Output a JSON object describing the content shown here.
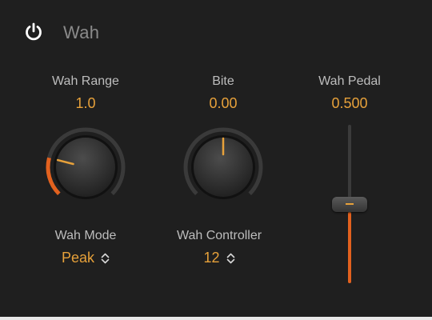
{
  "plugin": {
    "title": "Wah",
    "power_icon": "power-icon"
  },
  "colors": {
    "accent_orange": "#e2611e",
    "value_amber": "#e7a13a",
    "label_gray": "#bdbdbd",
    "background": "#1f1f1f"
  },
  "wah_range": {
    "label": "Wah Range",
    "value": "1.0",
    "level": 0.22
  },
  "bite": {
    "label": "Bite",
    "value": "0.00",
    "level": 0.0
  },
  "wah_pedal": {
    "label": "Wah Pedal",
    "value": "0.500",
    "level": 0.5
  },
  "wah_mode": {
    "label": "Wah Mode",
    "selected": "Peak",
    "icon": "chevron-updown-icon"
  },
  "wah_controller": {
    "label": "Wah Controller",
    "selected": "12",
    "icon": "chevron-updown-icon"
  }
}
